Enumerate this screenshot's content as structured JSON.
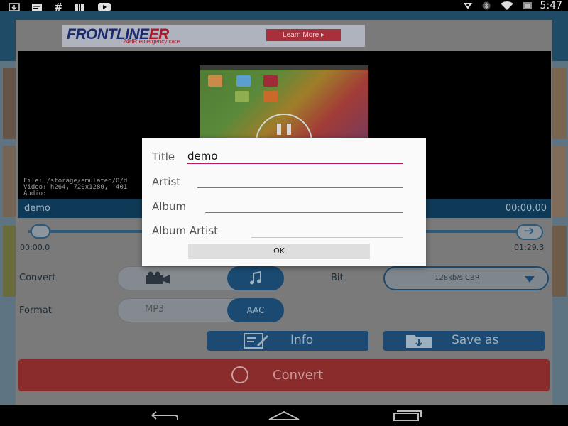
{
  "status_bar": {
    "time": "5:47",
    "left_icons": [
      "download-icon",
      "message-icon",
      "hash-icon",
      "barcode-icon",
      "youtube-icon"
    ],
    "right_icons": [
      "location-icon",
      "bluetooth-icon",
      "wifi-icon",
      "battery-icon"
    ]
  },
  "ad": {
    "brand_main": "FRONTLINE",
    "brand_accent": "ER",
    "tagline": "24HR emergency care",
    "cta": "Learn More ▸"
  },
  "player": {
    "file_info_line1": "File: /storage/emulated/0/d",
    "file_info_line2": "Video: h264, 720x1280,  401",
    "file_info_line3": "Audio:",
    "title": "demo",
    "current_time": "00:00.00",
    "range_start": "00:00.0",
    "range_end": "01:29.3"
  },
  "controls": {
    "convert_label": "Convert",
    "bit_label": "Bit",
    "bitrate_value": "128kb/s CBR",
    "format_label": "Format",
    "format_option_1": "MP3",
    "format_option_2": "AAC",
    "info_button": "Info",
    "save_as_button": "Save as",
    "convert_button": "Convert"
  },
  "dialog": {
    "title_label": "Title",
    "title_value": "demo",
    "artist_label": "Artist",
    "artist_value": "",
    "album_label": "Album",
    "album_value": "",
    "album_artist_label": "Album Artist",
    "album_artist_value": "",
    "ok_button": "OK"
  },
  "colors": {
    "accent": "#c2185b",
    "primary": "#1c4a72",
    "convert_red": "#8a2c2c"
  }
}
